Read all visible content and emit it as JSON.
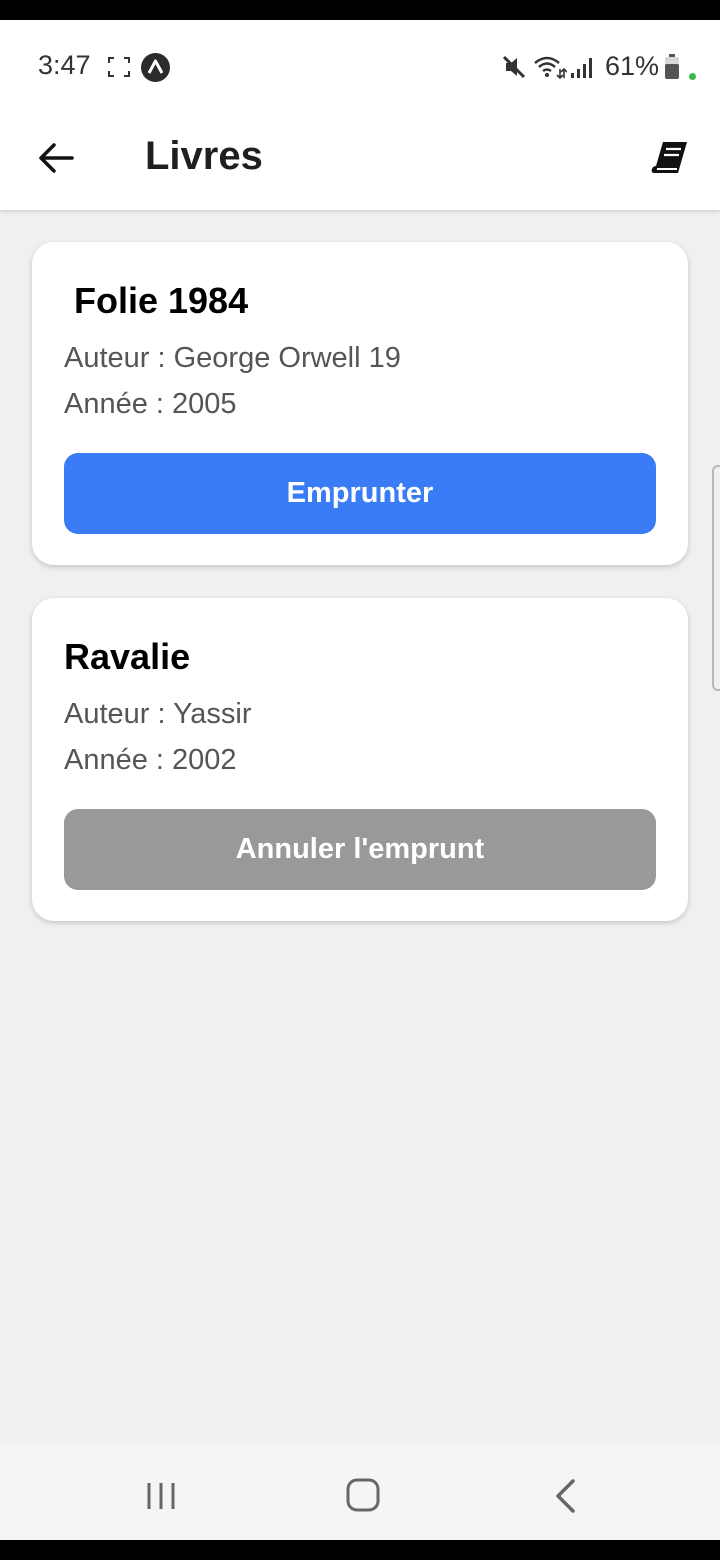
{
  "status_bar": {
    "time": "3:47",
    "battery_percent": "61%",
    "icons": [
      "screenshot-bracket-icon",
      "app-notification-icon",
      "mute-icon",
      "wifi-icon",
      "signal-icon",
      "battery-icon"
    ]
  },
  "header": {
    "title": "Livres",
    "back_icon": "arrow-left-icon",
    "action_icon": "book-icon"
  },
  "books": [
    {
      "title": "Folie 1984",
      "author": "Auteur : George Orwell 19",
      "year": "Année : 2005",
      "button_label": "Emprunter",
      "button_color": "#3a7cf5"
    },
    {
      "title": "Ravalie",
      "author": "Auteur : Yassir",
      "year": "Année : 2002",
      "button_label": "Annuler l'emprunt",
      "button_color": "#999999"
    }
  ],
  "nav_bar": {
    "icons": [
      "recents-icon",
      "home-icon",
      "back-icon"
    ]
  },
  "colors": {
    "primary": "#3a7cf5",
    "disabled": "#999999",
    "background": "#f0f0f0"
  }
}
